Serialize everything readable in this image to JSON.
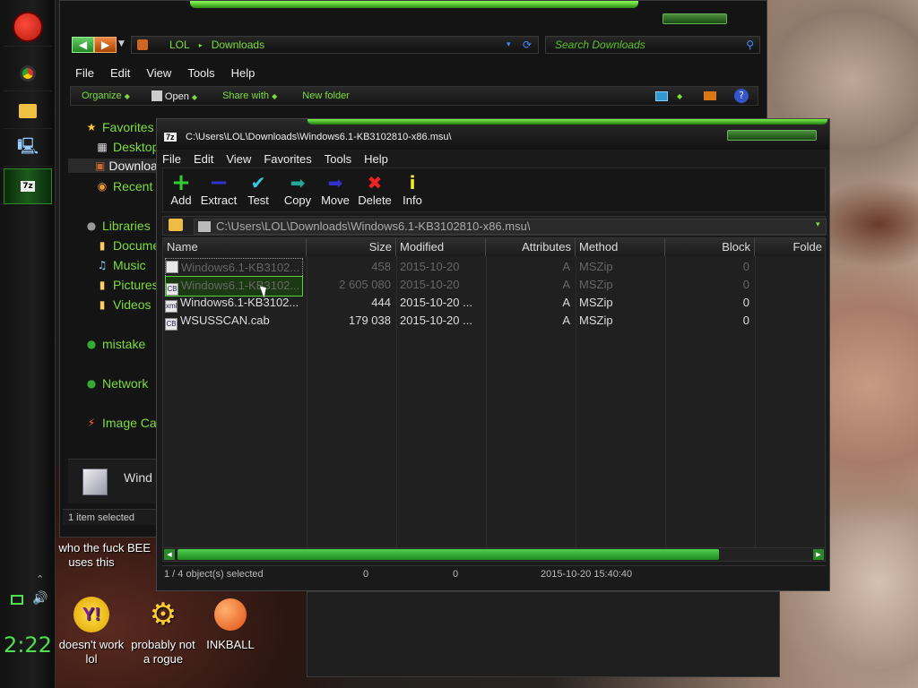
{
  "explorer": {
    "address_root": "LOL",
    "address_folder": "Downloads",
    "search_placeholder": "Search Downloads",
    "menu": [
      "File",
      "Edit",
      "View",
      "Tools",
      "Help"
    ],
    "toolbar": {
      "organize": "Organize",
      "open": "Open",
      "share_with": "Share with",
      "new_folder": "New folder"
    },
    "nav": {
      "favorites": "Favorites",
      "desktop": "Desktop",
      "downloads": "Downloa",
      "recent": "Recent",
      "libraries": "Libraries",
      "documents": "Docume",
      "music": "Music",
      "pictures": "Pictures",
      "videos": "Videos",
      "mistake": "mistake",
      "network": "Network",
      "image": "Image Ca"
    },
    "details_name": "Wind",
    "status": "1 item selected"
  },
  "sevenzip": {
    "title": "C:\\Users\\LOL\\Downloads\\Windows6.1-KB3102810-x86.msu\\",
    "title_icon": "7z",
    "menu": [
      "File",
      "Edit",
      "View",
      "Favorites",
      "Tools",
      "Help"
    ],
    "tools": [
      "Add",
      "Extract",
      "Test",
      "Copy",
      "Move",
      "Delete",
      "Info"
    ],
    "path": "C:\\Users\\LOL\\Downloads\\Windows6.1-KB3102810-x86.msu\\",
    "columns": [
      "Name",
      "Size",
      "Modified",
      "Attributes",
      "Method",
      "Block",
      "Folde"
    ],
    "rows": [
      {
        "name": "Windows6.1-KB3102...",
        "size": "458",
        "modified": "2015-10-20",
        "attr": "A",
        "method": "MSZip",
        "block": "0"
      },
      {
        "name": "Windows6.1-KB3102...",
        "size": "2 605 080",
        "modified": "2015-10-20",
        "attr": "A",
        "method": "MSZip",
        "block": "0"
      },
      {
        "name": "Windows6.1-KB3102...",
        "size": "444",
        "modified": "2015-10-20 ...",
        "attr": "A",
        "method": "MSZip",
        "block": "0"
      },
      {
        "name": "WSUSSCAN.cab",
        "size": "179 038",
        "modified": "2015-10-20 ...",
        "attr": "A",
        "method": "MSZip",
        "block": "0"
      }
    ],
    "status": {
      "selected": "1 / 4 object(s) selected",
      "size": "0",
      "packed": "0",
      "date": "2015-10-20 15:40:40"
    }
  },
  "desktop": {
    "icons": [
      {
        "label": "who the fuck uses this"
      },
      {
        "label": "BEE"
      },
      {
        "label": "doesn't work lol"
      },
      {
        "label": "probably not a rogue"
      },
      {
        "label": "INKBALL"
      }
    ]
  },
  "taskbar": {
    "clock": "2:22"
  },
  "colors": {
    "accent": "#4fe04f",
    "window_bg": "#141414",
    "text": "#dddddd"
  }
}
